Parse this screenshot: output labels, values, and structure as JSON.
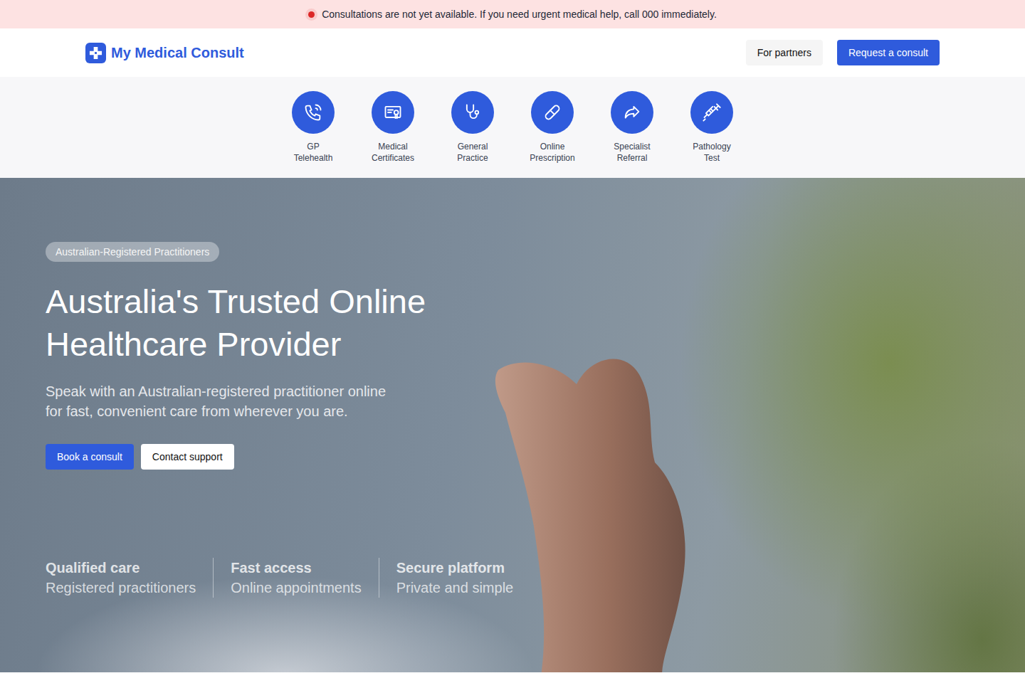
{
  "alert": {
    "text": "Consultations are not yet available. If you need urgent medical help, call 000 immediately."
  },
  "brand": {
    "name": "My Medical Consult"
  },
  "nav": {
    "buttons": [
      "For partners",
      "Request a consult"
    ]
  },
  "services": [
    {
      "label": "GP Telehealth"
    },
    {
      "label": "Medical Certificates"
    },
    {
      "label": "General Practice"
    },
    {
      "label": "Online Prescription"
    },
    {
      "label": "Specialist Referral"
    },
    {
      "label": "Pathology Test"
    }
  ],
  "hero": {
    "badge": "Australian-Registered Practitioners",
    "title": "Australia's Trusted Online Healthcare Provider",
    "subtitle": "Speak with an Australian-registered practitioner online for fast, convenient care from wherever you are.",
    "buttons": [
      "Book a consult",
      "Contact support"
    ],
    "stats": [
      {
        "title": "Qualified care",
        "subtitle": "Registered practitioners"
      },
      {
        "title": "Fast access",
        "subtitle": "Online appointments"
      },
      {
        "title": "Secure platform",
        "subtitle": "Private and simple"
      }
    ]
  }
}
